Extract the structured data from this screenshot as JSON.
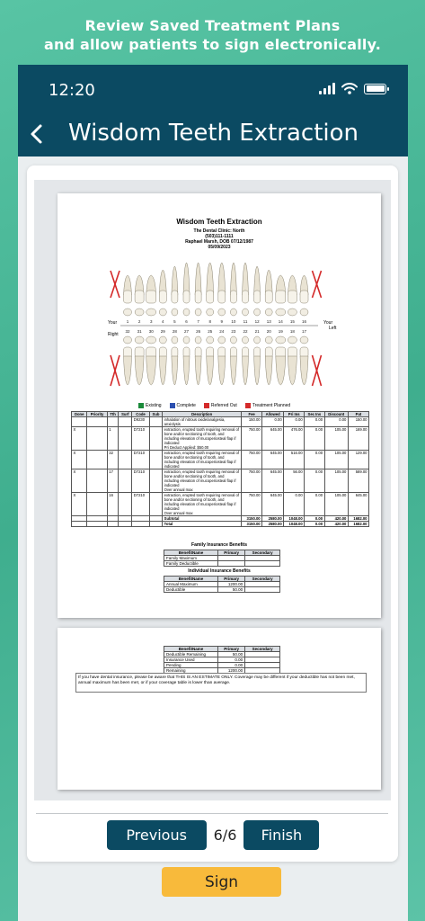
{
  "promo": {
    "line1": "Review Saved Treatment Plans",
    "line2": "and allow patients to sign electronically."
  },
  "status": {
    "time": "12:20"
  },
  "header": {
    "title": "Wisdom Teeth Extraction",
    "back_icon": "chevron-left-icon"
  },
  "document": {
    "title": "Wisdom Teeth Extraction",
    "clinic_name": "The Dental Clinic: North",
    "clinic_phone": "(503)111-1111",
    "patient": "Raphael Marsh, DOB 07/12/1987",
    "date": "05/09/2023",
    "side_labels": {
      "your_right": "Your",
      "right": "Right",
      "your_left": "Your",
      "left": "Left"
    },
    "upper_numbers": [
      "1",
      "2",
      "3",
      "4",
      "5",
      "6",
      "7",
      "8",
      "9",
      "10",
      "11",
      "12",
      "13",
      "14",
      "15",
      "16"
    ],
    "lower_numbers": [
      "32",
      "31",
      "30",
      "29",
      "28",
      "27",
      "26",
      "25",
      "24",
      "23",
      "22",
      "21",
      "20",
      "19",
      "18",
      "17"
    ],
    "legend": [
      {
        "label": "Existing",
        "color": "#1a8a3a"
      },
      {
        "label": "Complete",
        "color": "#2b4fb0"
      },
      {
        "label": "Referred Out",
        "color": "#d42a2a"
      },
      {
        "label": "Treatment Planned",
        "color": "#d42a2a"
      }
    ],
    "procedure_headers": [
      "Done",
      "Priority",
      "Tth",
      "Surf",
      "Code",
      "Sub",
      "Description",
      "Fee",
      "Allowed",
      "Pri Ins",
      "Sec Ins",
      "Discount",
      "Pat"
    ],
    "procedures": [
      [
        "",
        "",
        "",
        "",
        "D9230",
        "",
        "inhalation of nitrous oxide/analgesia, anxiolysis",
        "150.00",
        "0.00",
        "0.00",
        "0.00",
        "0.00",
        "150.00"
      ],
      [
        "X",
        "",
        "1",
        "",
        "D7210",
        "",
        "extraction, erupted tooth requiring removal of bone and/or sectioning of tooth, and including elevation of mucoperiosteal flap if indicated\nPri Deduct Applied: $50.00",
        "750.00",
        "645.00",
        "476.00",
        "0.00",
        "105.00",
        "169.00"
      ],
      [
        "X",
        "",
        "32",
        "",
        "D7210",
        "",
        "extraction, erupted tooth requiring removal of bone and/or sectioning of tooth, and including elevation of mucoperiosteal flap if indicated",
        "750.00",
        "645.00",
        "516.00",
        "0.00",
        "105.00",
        "129.00"
      ],
      [
        "X",
        "",
        "17",
        "",
        "D7210",
        "",
        "extraction, erupted tooth requiring removal of bone and/or sectioning of tooth, and including elevation of mucoperiosteal flap if indicated\nOver annual max",
        "750.00",
        "645.00",
        "56.00",
        "0.00",
        "105.00",
        "589.00"
      ],
      [
        "X",
        "",
        "16",
        "",
        "D7210",
        "",
        "extraction, erupted tooth requiring removal of bone and/or sectioning of tooth, and including elevation of mucoperiosteal flap if indicated\nOver annual max",
        "750.00",
        "645.00",
        "0.00",
        "0.00",
        "105.00",
        "645.00"
      ]
    ],
    "subtotal": [
      "",
      "",
      "",
      "",
      "",
      "",
      "Subtotal",
      "3150.00",
      "2580.00",
      "1048.00",
      "0.00",
      "420.00",
      "1682.00"
    ],
    "total": [
      "",
      "",
      "",
      "",
      "",
      "",
      "Total",
      "3150.00",
      "2580.00",
      "1048.00",
      "0.00",
      "420.00",
      "1682.00"
    ],
    "family_title": "Family Insurance Benefits",
    "family_headers": [
      "BenefitName",
      "Primary",
      "Secondary"
    ],
    "family_rows": [
      [
        "Family Maximum",
        "",
        ""
      ],
      [
        "Family Deductible",
        "",
        ""
      ]
    ],
    "individual_title": "Individual Insurance Benefits",
    "individual_headers": [
      "BenefitName",
      "Primary",
      "Secondary"
    ],
    "individual_rows": [
      [
        "Annual Maximum",
        "1200.00",
        ""
      ],
      [
        "Deductible",
        "50.00",
        ""
      ]
    ],
    "page2_headers": [
      "BenefitName",
      "Primary",
      "Secondary"
    ],
    "page2_rows": [
      [
        "Deductible Remaining",
        "50.00",
        ""
      ],
      [
        "Insurance Used",
        "0.00",
        ""
      ],
      [
        "Pending",
        "0.00",
        ""
      ],
      [
        "Remaining",
        "1200.00",
        ""
      ]
    ],
    "disclaimer": "If you have dental insurance, please be aware that THIS IS AN ESTIMATE ONLY.  Coverage may be different if your deductible has not been met, annual maximum has been met, or if your coverage table is lower than average."
  },
  "actions": {
    "sign": "Sign",
    "previous": "Previous",
    "page_indicator": "6/6",
    "finish": "Finish"
  },
  "colors": {
    "accent": "#0b4a62",
    "sign": "#f8ba3b",
    "background": "#4cb898"
  }
}
